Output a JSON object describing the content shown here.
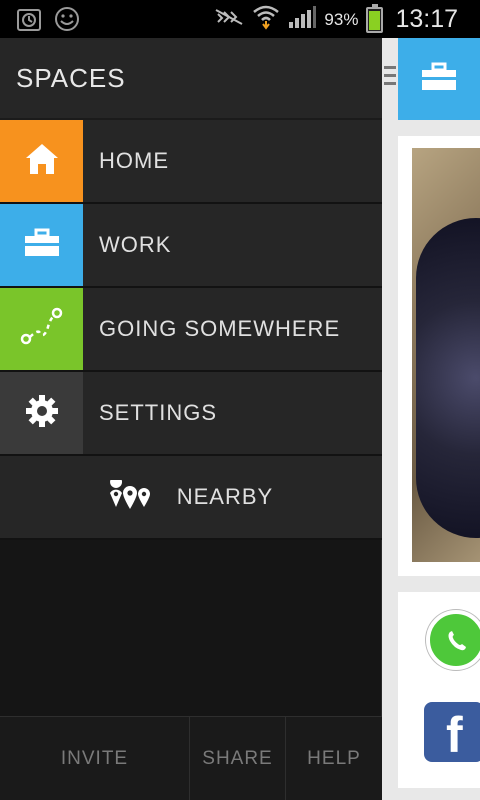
{
  "status_bar": {
    "battery_percent": "93%",
    "time": "13:17",
    "icons": [
      "alarm-icon",
      "smiley-icon",
      "mute-icon",
      "wifi-icon",
      "signal-icon",
      "battery-icon"
    ]
  },
  "drawer": {
    "title": "SPACES",
    "items": [
      {
        "label": "HOME",
        "icon": "home-icon",
        "color": "#f7921e"
      },
      {
        "label": "WORK",
        "icon": "briefcase-icon",
        "color": "#3daee9"
      },
      {
        "label": "GOING SOMEWHERE",
        "icon": "route-icon",
        "color": "#7ac52a"
      },
      {
        "label": "SETTINGS",
        "icon": "gear-icon",
        "color": "#3a3a3a"
      }
    ],
    "nearby": {
      "label": "NEARBY",
      "icon": "map-pins-icon"
    },
    "footer": {
      "invite": "INVITE",
      "share": "SHARE",
      "help": "HELP"
    }
  },
  "background": {
    "header_icon": "briefcase-icon",
    "apps": [
      "whatsapp-icon",
      "facebook-icon"
    ],
    "facebook_letter": "f"
  }
}
